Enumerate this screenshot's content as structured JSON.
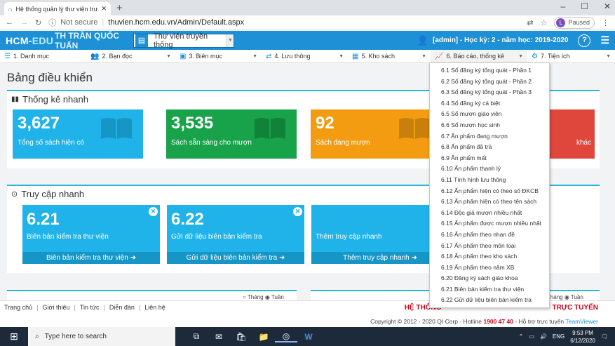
{
  "browser": {
    "tab_title": "Hệ thống quản lý thư viện trườ",
    "not_secure": "Not secure",
    "url": "thuvien.hcm.edu.vn/Admin/Default.aspx",
    "profile_initial": "L",
    "paused": "Paused"
  },
  "header": {
    "brand_a": "HCM-",
    "brand_b": "EDU",
    "school": "TH TRẦN QUỐC TUẤN",
    "library_select": "Thư viện truyền thống",
    "user_info": "[admin] - Học kỳ: 2 - năm học: 2019-2020",
    "help": "?"
  },
  "menu": [
    {
      "label": "1. Danh mục",
      "icon": "list-icon"
    },
    {
      "label": "2. Bạn đọc",
      "icon": "reader-icon"
    },
    {
      "label": "3. Biên mục",
      "icon": "catalog-icon"
    },
    {
      "label": "4. Lưu thông",
      "icon": "circulation-icon"
    },
    {
      "label": "5. Kho sách",
      "icon": "warehouse-icon"
    },
    {
      "label": "6. Báo cáo, thống kê",
      "icon": "chart-icon"
    },
    {
      "label": "7. Tiện ích",
      "icon": "gear-icon"
    }
  ],
  "page": {
    "title": "Bảng điều khiển"
  },
  "stats_panel": {
    "title": "Thống kê nhanh",
    "cards": [
      {
        "value": "3,627",
        "label": "Tổng số sách hiện có",
        "color": "#1fb3ea"
      },
      {
        "value": "3,535",
        "label": "Sách sẵn sàng cho mượn",
        "color": "#18a34a"
      },
      {
        "value": "92",
        "label": "Sách đang mượn",
        "color": "#f39c12"
      },
      {
        "value": "",
        "label": "khác",
        "color": "#e0473c"
      }
    ]
  },
  "quick_panel": {
    "title": "Truy cập nhanh",
    "cards": [
      {
        "value": "6.21",
        "label": "Biên bản kiểm tra thư viện",
        "footer": "Biên bản kiểm tra thư viện"
      },
      {
        "value": "6.22",
        "label": "Gửi dữ liệu biên bản kiểm tra",
        "footer": "Gửi dữ liệu biên bản kiểm tra"
      },
      {
        "value": "",
        "label": "Thêm truy cập nhanh",
        "footer": "Thêm truy cập nhanh"
      }
    ]
  },
  "bottom_radio": {
    "month": "Tháng",
    "week": "Tuần"
  },
  "dropdown": [
    "6.1 Sổ đăng ký tổng quát - Phần 1",
    "6.2 Sổ đăng ký tổng quát - Phần 2",
    "6.3 Sổ đăng ký tổng quát - Phần 3",
    "6.4 Sổ đăng ký cá biệt",
    "6.5 Sổ mượn giáo viên",
    "6.6 Sổ mượn học sinh",
    "6.7 Ấn phẩm đang mượn",
    "6.8 Ấn phẩm đã trả",
    "6.9 Ấn phẩm mất",
    "6.10 Ấn phẩm thanh lý",
    "6.11 Tình hình lưu thông",
    "6.12 Ấn phẩm hiện có theo số ĐKCB",
    "6.13 Ấn phẩm hiện có theo tên sách",
    "6.14 Độc giả mượn nhiều nhất",
    "6.15 Ấn phẩm được mượn nhiều nhất",
    "6.16 Ấn phẩm theo nhan đề",
    "6.17 Ấn phẩm theo môn loại",
    "6.18 Ấn phẩm theo kho sách",
    "6.19 Ấn phẩm theo năm XB",
    "6.20 Đăng ký sách giáo khoa",
    "6.21 Biên bản kiểm tra thư viện",
    "6.22 Gửi dữ liệu biên bản kiểm tra"
  ],
  "footer": {
    "links": [
      "Trang chủ",
      "Giới thiệu",
      "Tin tức",
      "Diễn đàn",
      "Liên hệ"
    ],
    "slogan_left": "HỆ THỐNG",
    "slogan_right": "TRỰC TUYẾN",
    "copyright": "Copyright © 2012 - 2020 QI Corp - Hotline",
    "hotline": "1900 47 40",
    "support": "- Hỗ trợ trực tuyến",
    "teamviewer": "TeamViewer"
  },
  "taskbar": {
    "search_placeholder": "Type here to search",
    "lang": "ENG",
    "time": "9:53 PM",
    "date": "6/12/2020"
  }
}
